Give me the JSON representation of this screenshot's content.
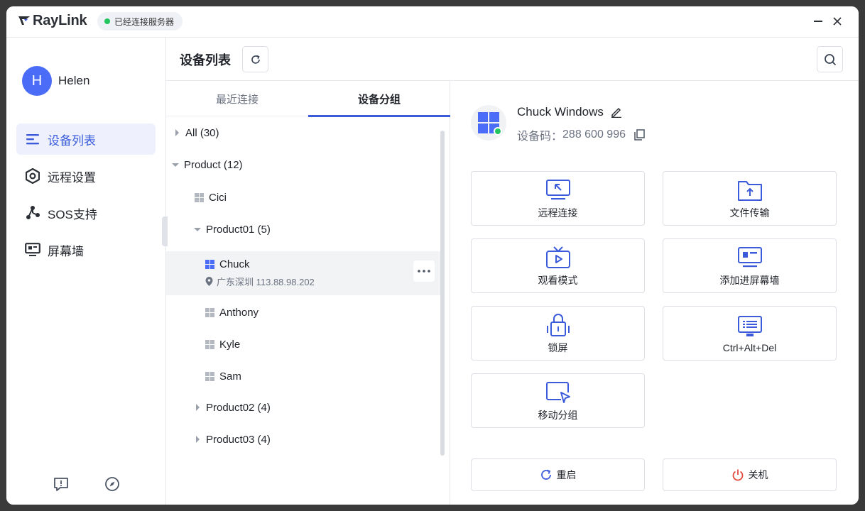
{
  "app": {
    "brand": "RayLink",
    "status": "已经连接服务器"
  },
  "user": {
    "initial": "H",
    "name": "Helen"
  },
  "sidebar": {
    "items": [
      {
        "label": "设备列表",
        "icon": "list-icon",
        "active": true
      },
      {
        "label": "远程设置",
        "icon": "settings-hex-icon"
      },
      {
        "label": "SOS支持",
        "icon": "share-nodes-icon"
      },
      {
        "label": "屏幕墙",
        "icon": "monitor-icon"
      }
    ],
    "bottom_icons": [
      "feedback-icon",
      "compass-icon"
    ]
  },
  "header": {
    "title": "设备列表"
  },
  "tabs": [
    {
      "label": "最近连接",
      "active": false
    },
    {
      "label": "设备分组",
      "active": true
    }
  ],
  "tree": {
    "all": "All (30)",
    "product": "Product (12)",
    "cici": "Cici",
    "product01": "Product01 (5)",
    "chuck": {
      "name": "Chuck",
      "location": "广东深圳 113.88.98.202"
    },
    "anthony": "Anthony",
    "kyle": "Kyle",
    "sam": "Sam",
    "product02": "Product02 (4)",
    "product03": "Product03 (4)"
  },
  "device": {
    "name": "Chuck Windows",
    "code_label": "设备码：",
    "code": "288 600 996",
    "status_color": "#22c55e"
  },
  "actions": [
    {
      "label": "远程连接",
      "icon": "remote-connect-icon"
    },
    {
      "label": "文件传输",
      "icon": "folder-upload-icon"
    },
    {
      "label": "观看模式",
      "icon": "tv-play-icon"
    },
    {
      "label": "添加进屏幕墙",
      "icon": "screen-wall-icon"
    },
    {
      "label": "锁屏",
      "icon": "lock-icon"
    },
    {
      "label": "Ctrl+Alt+Del",
      "icon": "keyboard-screen-icon"
    },
    {
      "label": "移动分组",
      "icon": "move-group-icon"
    }
  ],
  "bottom": {
    "restart": "重启",
    "shutdown": "关机"
  },
  "colors": {
    "accent": "#3b5bdb",
    "online": "#22c55e",
    "danger": "#e5483d"
  }
}
